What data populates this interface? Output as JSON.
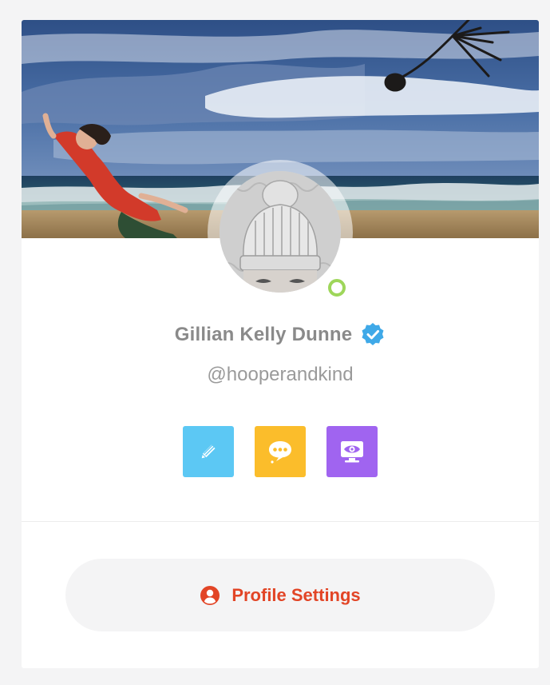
{
  "profile": {
    "name": "Gillian Kelly Dunne",
    "handle": "@hooperandkind",
    "online": true,
    "verified": true
  },
  "actions": [
    {
      "icon": "pencil-icon",
      "color": "#5cc8f4"
    },
    {
      "icon": "chat-bubble-icon",
      "color": "#fbbd2b"
    },
    {
      "icon": "eye-monitor-icon",
      "color": "#a064f0"
    }
  ],
  "settings": {
    "label": "Profile Settings",
    "icon": "user-circle-icon",
    "color": "#e24526"
  },
  "colors": {
    "online": "#9ed65a",
    "verified": "#3fa9e8",
    "background": "#f4f4f5"
  }
}
